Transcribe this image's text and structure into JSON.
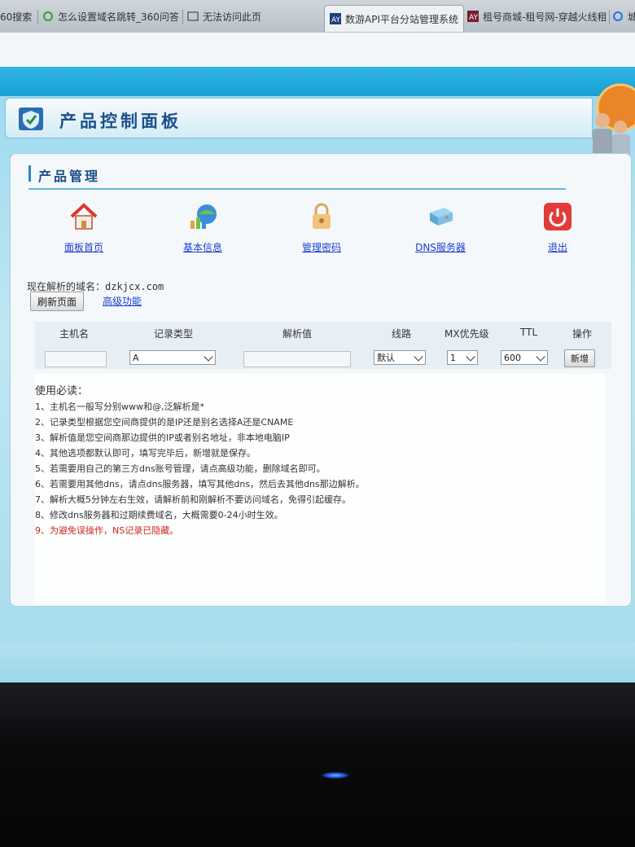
{
  "browser": {
    "tabs": [
      {
        "label": "60搜索"
      },
      {
        "label": "怎么设置域名跳转_360问答"
      },
      {
        "label": "无法访问此页"
      },
      {
        "label": "数游API平台分站管理系统"
      },
      {
        "label": "租号商城-租号网-穿越火线租"
      },
      {
        "label": "城"
      }
    ]
  },
  "header": {
    "title": "产品控制面板"
  },
  "section": {
    "title": "产品管理"
  },
  "nav": [
    {
      "label": "面板首页",
      "icon": "home-icon"
    },
    {
      "label": "基本信息",
      "icon": "info-globe-icon"
    },
    {
      "label": "管理密码",
      "icon": "lock-icon"
    },
    {
      "label": "DNS服务器",
      "icon": "server-icon"
    },
    {
      "label": "退出",
      "icon": "power-icon"
    }
  ],
  "domain": {
    "label": "现在解析的域名：",
    "value": "dzkjcx.com"
  },
  "actions": {
    "refresh": "刷新页面",
    "advanced": "高级功能"
  },
  "record_form": {
    "headers": [
      "主机名",
      "记录类型",
      "解析值",
      "线路",
      "MX优先级",
      "TTL",
      "操作"
    ],
    "host_value": "",
    "record_type": "A",
    "value": "",
    "line": "默认",
    "mx_priority": "1",
    "ttl": "600",
    "add_button": "新增"
  },
  "notes": {
    "title": "使用必读：",
    "items": [
      "1、主机名一般写分别www和@,泛解析是*",
      "2、记录类型根据您空间商提供的是IP还是别名选择A还是CNAME",
      "3、解析值是您空间商那边提供的IP或者别名地址，非本地电脑IP",
      "4、其他选项都默认即可，填写完毕后，新增就是保存。",
      "5、若需要用自己的第三方dns账号管理，请点高级功能，删除域名即可。",
      "6、若需要用其他dns，请点dns服务器，填写其他dns，然后去其他dns那边解析。",
      "7、解析大概5分钟左右生效，请解析前和刚解析不要访问域名，免得引起缓存。",
      "8、修改dns服务器和过期续费域名，大概需要0-24小时生效。",
      "9、为避免误操作，NS记录已隐藏。"
    ]
  },
  "colors": {
    "accent": "#1d4f8c",
    "link": "#1b3fd1",
    "warning": "#d42323",
    "banner": "#17a0d4"
  }
}
